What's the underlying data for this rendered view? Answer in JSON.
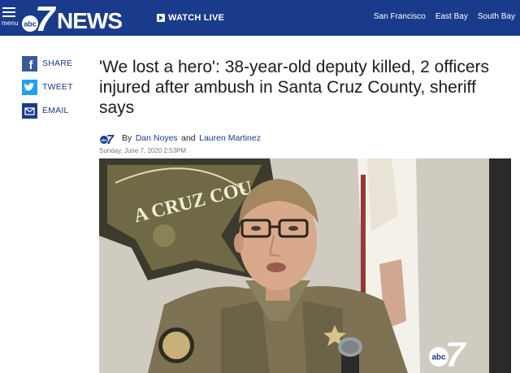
{
  "header": {
    "menu_label": "menu",
    "logo": {
      "network": "abc",
      "channel": "7",
      "brand": "NEWS"
    },
    "watch_live_label": "WATCH LIVE",
    "regions": [
      "San Francisco",
      "East Bay",
      "South Bay"
    ]
  },
  "share": {
    "facebook_label": "SHARE",
    "twitter_label": "TWEET",
    "email_label": "EMAIL"
  },
  "article": {
    "headline": "'We lost a hero': 38-year-old deputy killed, 2 officers injured after ambush in Santa Cruz County, sheriff says",
    "byline_prefix": "By",
    "author_1": "Dan Noyes",
    "byline_joiner": "and",
    "author_2": "Lauren Martinez",
    "date": "Sunday, June 7, 2020 2:53PM"
  },
  "hero_image": {
    "seal_text": "A CRUZ COU",
    "overlay_network": "abc",
    "overlay_channel": "7"
  },
  "colors": {
    "header_bg": "#1a3b8c",
    "facebook": "#3b5998",
    "twitter": "#1da1f2",
    "link": "#1a3b8c"
  },
  "icons": [
    "menu-icon",
    "play-icon",
    "facebook-icon",
    "twitter-icon",
    "email-icon",
    "abc7-logo"
  ]
}
